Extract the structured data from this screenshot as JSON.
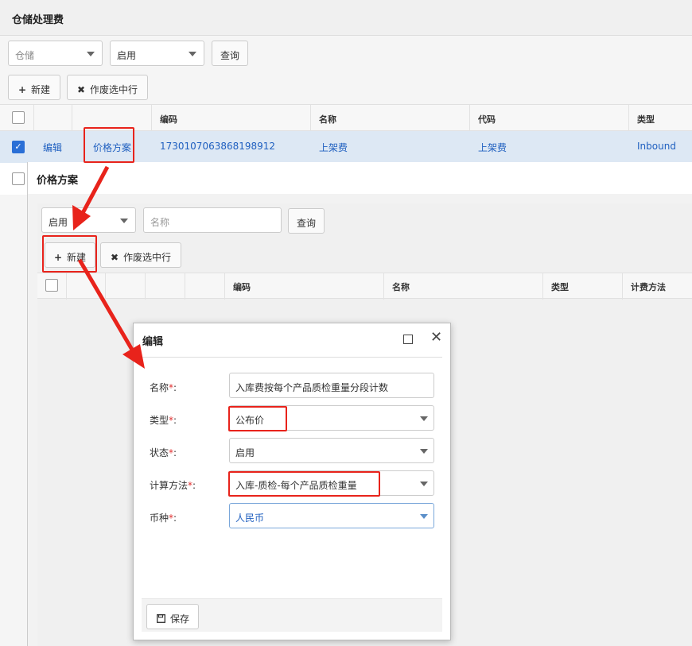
{
  "page": {
    "title": "仓储处理费",
    "filter1_value": "仓储",
    "filter2_value": "启用",
    "query_label": "查询",
    "new_label": "新建",
    "void_label": "作废选中行"
  },
  "grid": {
    "headers": [
      "编码",
      "名称",
      "代码",
      "类型"
    ],
    "row1": {
      "edit_link": "编辑",
      "price_link": "价格方案",
      "code": "1730107063868198912",
      "name": "上架费",
      "short_code": "上架费",
      "type": "Inbound"
    }
  },
  "price_window": {
    "title": "价格方案",
    "status_value": "启用",
    "name_placeholder": "名称",
    "query_label": "查询",
    "new_label": "新建",
    "void_label": "作废选中行",
    "headers": [
      "编码",
      "名称",
      "类型",
      "计费方法"
    ]
  },
  "edit_dialog": {
    "title": "编辑",
    "fields": {
      "name": {
        "label": "名称",
        "value": "入库费按每个产品质检重量分段计数"
      },
      "type": {
        "label": "类型",
        "value": "公布价"
      },
      "status": {
        "label": "状态",
        "value": "启用"
      },
      "method": {
        "label": "计算方法",
        "value": "入库-质检-每个产品质检重量"
      },
      "currency": {
        "label": "币种",
        "value": "人民币"
      }
    },
    "required_mark": "*",
    "colon": ":",
    "save_label": "保存"
  },
  "colors": {
    "annotation": "#e8231b",
    "link": "#2060c0",
    "selected_row": "#dde8f4"
  },
  "icons": [
    "plus-icon",
    "x-icon",
    "save-icon",
    "maximize-icon",
    "close-icon",
    "chevron-down-icon",
    "checkbox-icon"
  ]
}
